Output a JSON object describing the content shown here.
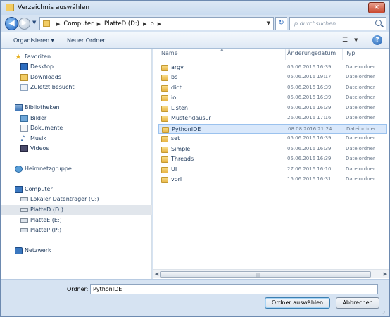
{
  "window": {
    "title": "Verzeichnis auswählen",
    "close": "×"
  },
  "address": {
    "crumbs": [
      "Computer",
      "PlatteD (D:)",
      "p"
    ],
    "search_placeholder": "p durchsuchen"
  },
  "toolbar": {
    "organize": "Organisieren ▾",
    "new_folder": "Neuer Ordner",
    "help": "?"
  },
  "nav": {
    "favorites": "Favoriten",
    "desktop": "Desktop",
    "downloads": "Downloads",
    "recent": "Zuletzt besucht",
    "libraries": "Bibliotheken",
    "pictures": "Bilder",
    "documents": "Dokumente",
    "music": "Musik",
    "videos": "Videos",
    "homegroup": "Heimnetzgruppe",
    "computer": "Computer",
    "drive_c": "Lokaler Datenträger (C:)",
    "drive_d": "PlatteD (D:)",
    "drive_e": "PlatteE (E:)",
    "drive_p": "PlatteP (P:)",
    "network": "Netzwerk"
  },
  "columns": {
    "name": "Name",
    "date": "Änderungsdatum",
    "type": "Typ"
  },
  "files": [
    {
      "name": "argv",
      "date": "05.06.2016 16:39",
      "type": "Dateiordner"
    },
    {
      "name": "bs",
      "date": "05.06.2016 19:17",
      "type": "Dateiordner"
    },
    {
      "name": "dict",
      "date": "05.06.2016 16:39",
      "type": "Dateiordner"
    },
    {
      "name": "io",
      "date": "05.06.2016 16:39",
      "type": "Dateiordner"
    },
    {
      "name": "Listen",
      "date": "05.06.2016 16:39",
      "type": "Dateiordner"
    },
    {
      "name": "Musterklausur",
      "date": "26.06.2016 17:16",
      "type": "Dateiordner"
    },
    {
      "name": "PythonIDE",
      "date": "08.08.2016 21:24",
      "type": "Dateiordner"
    },
    {
      "name": "set",
      "date": "05.06.2016 16:39",
      "type": "Dateiordner"
    },
    {
      "name": "Simple",
      "date": "05.06.2016 16:39",
      "type": "Dateiordner"
    },
    {
      "name": "Threads",
      "date": "05.06.2016 16:39",
      "type": "Dateiordner"
    },
    {
      "name": "UI",
      "date": "27.06.2016 16:10",
      "type": "Dateiordner"
    },
    {
      "name": "vorl",
      "date": "15.06.2016 16:31",
      "type": "Dateiordner"
    }
  ],
  "footer": {
    "folder_label": "Ordner:",
    "folder_value": "PythonIDE",
    "select_button": "Ordner auswählen",
    "cancel_button": "Abbrechen"
  }
}
